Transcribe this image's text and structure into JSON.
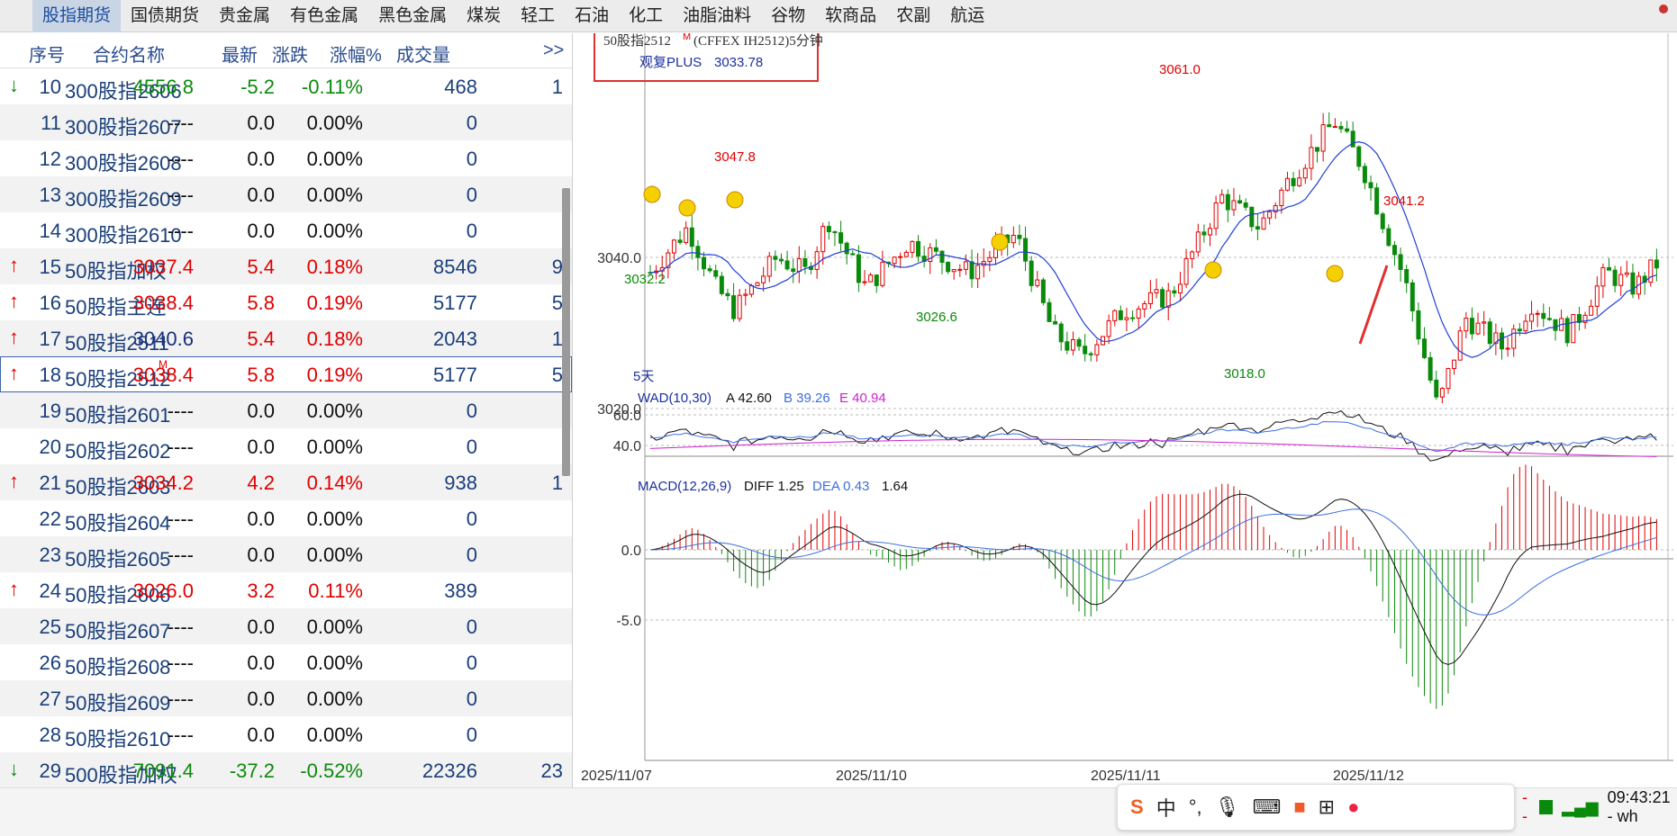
{
  "nav": {
    "tabs": [
      "股指期货",
      "国债期货",
      "贵金属",
      "有色金属",
      "黑色金属",
      "煤炭",
      "轻工",
      "石油",
      "化工",
      "油脂油料",
      "谷物",
      "软商品",
      "农副",
      "航运"
    ],
    "active_index": 0
  },
  "table": {
    "headers": {
      "idx": "序号",
      "name": "合约名称",
      "last": "最新",
      "chg": "涨跌",
      "pct": "涨幅%",
      "vol": "成交量",
      "more": ">>"
    },
    "rows": [
      {
        "arrow": "↓",
        "dir": "down",
        "idx": "10",
        "name": "300股指2606",
        "last": "4556.8",
        "chg": "-5.2",
        "pct": "-0.11%",
        "vol": "468",
        "ext": "1"
      },
      {
        "arrow": "",
        "dir": "flat",
        "idx": "11",
        "name": "300股指2607",
        "last": "----",
        "chg": "0.0",
        "pct": "0.00%",
        "vol": "0",
        "ext": ""
      },
      {
        "arrow": "",
        "dir": "flat",
        "idx": "12",
        "name": "300股指2608",
        "last": "----",
        "chg": "0.0",
        "pct": "0.00%",
        "vol": "0",
        "ext": ""
      },
      {
        "arrow": "",
        "dir": "flat",
        "idx": "13",
        "name": "300股指2609",
        "last": "----",
        "chg": "0.0",
        "pct": "0.00%",
        "vol": "0",
        "ext": ""
      },
      {
        "arrow": "",
        "dir": "flat",
        "idx": "14",
        "name": "300股指2610",
        "last": "----",
        "chg": "0.0",
        "pct": "0.00%",
        "vol": "0",
        "ext": ""
      },
      {
        "arrow": "↑",
        "dir": "up",
        "idx": "15",
        "name": "50股指加权",
        "last": "3037.4",
        "chg": "5.4",
        "pct": "0.18%",
        "vol": "8546",
        "ext": "9"
      },
      {
        "arrow": "↑",
        "dir": "up",
        "idx": "16",
        "name": "50股指主连",
        "last": "3038.4",
        "chg": "5.8",
        "pct": "0.19%",
        "vol": "5177",
        "ext": "5"
      },
      {
        "arrow": "↑",
        "dir": "up",
        "idx": "17",
        "name": "50股指2511",
        "last": "3040.6",
        "chg": "5.4",
        "pct": "0.18%",
        "vol": "2043",
        "ext": "1",
        "lastcolor": "blue"
      },
      {
        "arrow": "↑",
        "dir": "up",
        "idx": "18",
        "name": "50股指2512",
        "sup": "M",
        "last": "3038.4",
        "chg": "5.8",
        "pct": "0.19%",
        "vol": "5177",
        "ext": "5",
        "selected": true
      },
      {
        "arrow": "",
        "dir": "flat",
        "idx": "19",
        "name": "50股指2601",
        "last": "----",
        "chg": "0.0",
        "pct": "0.00%",
        "vol": "0",
        "ext": ""
      },
      {
        "arrow": "",
        "dir": "flat",
        "idx": "20",
        "name": "50股指2602",
        "last": "----",
        "chg": "0.0",
        "pct": "0.00%",
        "vol": "0",
        "ext": ""
      },
      {
        "arrow": "↑",
        "dir": "up",
        "idx": "21",
        "name": "50股指2603",
        "last": "3034.2",
        "chg": "4.2",
        "pct": "0.14%",
        "vol": "938",
        "ext": "1"
      },
      {
        "arrow": "",
        "dir": "flat",
        "idx": "22",
        "name": "50股指2604",
        "last": "----",
        "chg": "0.0",
        "pct": "0.00%",
        "vol": "0",
        "ext": ""
      },
      {
        "arrow": "",
        "dir": "flat",
        "idx": "23",
        "name": "50股指2605",
        "last": "----",
        "chg": "0.0",
        "pct": "0.00%",
        "vol": "0",
        "ext": ""
      },
      {
        "arrow": "↑",
        "dir": "up",
        "idx": "24",
        "name": "50股指2606",
        "last": "3026.0",
        "chg": "3.2",
        "pct": "0.11%",
        "vol": "389",
        "ext": ""
      },
      {
        "arrow": "",
        "dir": "flat",
        "idx": "25",
        "name": "50股指2607",
        "last": "----",
        "chg": "0.0",
        "pct": "0.00%",
        "vol": "0",
        "ext": ""
      },
      {
        "arrow": "",
        "dir": "flat",
        "idx": "26",
        "name": "50股指2608",
        "last": "----",
        "chg": "0.0",
        "pct": "0.00%",
        "vol": "0",
        "ext": ""
      },
      {
        "arrow": "",
        "dir": "flat",
        "idx": "27",
        "name": "50股指2609",
        "last": "----",
        "chg": "0.0",
        "pct": "0.00%",
        "vol": "0",
        "ext": ""
      },
      {
        "arrow": "",
        "dir": "flat",
        "idx": "28",
        "name": "50股指2610",
        "last": "----",
        "chg": "0.0",
        "pct": "0.00%",
        "vol": "0",
        "ext": ""
      },
      {
        "arrow": "↓",
        "dir": "down",
        "idx": "29",
        "name": "500股指加权",
        "last": "7091.4",
        "chg": "-37.2",
        "pct": "-0.52%",
        "vol": "22326",
        "ext": "23"
      }
    ]
  },
  "chart": {
    "contract_title": "50股指2512",
    "contract_sup": "M",
    "contract_detail": "(CFFEX IH2512)5分钟",
    "indicator_name": "观复PLUS",
    "indicator_value": "3033.78",
    "period_label": "5天",
    "price_ticks": [
      "3040.0",
      "3020.0"
    ],
    "annotations": [
      "3061.0",
      "3047.8",
      "3041.2",
      "3032.2",
      "3026.6",
      "3018.0"
    ],
    "date_labels": [
      "2025/11/07",
      "2025/11/10",
      "2025/11/11",
      "2025/11/12"
    ],
    "wad": {
      "title": "WAD(10,30)",
      "a_label": "A 42.60",
      "b_label": "B 39.26",
      "e_label": "E 40.94",
      "ticks": [
        "60.0",
        "40.0"
      ]
    },
    "macd": {
      "title": "MACD(12,26,9)",
      "diff_label": "DIFF 1.25",
      "dea_label": "DEA 0.43",
      "macd_value": "1.64",
      "ticks": [
        "0.0",
        "-5.0"
      ]
    },
    "colors": {
      "up": "#e00000",
      "down": "#0a8a0a",
      "ma": "#1f3fd8",
      "dea": "#3b6fe0",
      "e_line": "#d020d0",
      "frame": "#e03030"
    }
  },
  "tray": {
    "ime_items": [
      "中",
      "°,"
    ],
    "clock": "09:43:21 - wh"
  }
}
